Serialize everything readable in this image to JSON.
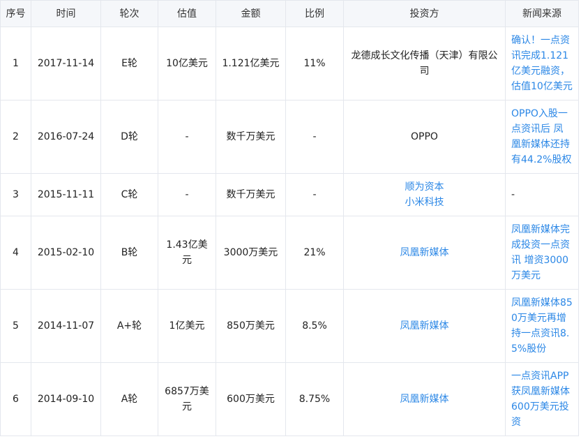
{
  "headers": {
    "index": "序号",
    "date": "时间",
    "round": "轮次",
    "valuation": "估值",
    "amount": "金额",
    "ratio": "比例",
    "investors": "投资方",
    "news": "新闻来源"
  },
  "rows": [
    {
      "index": "1",
      "date": "2017-11-14",
      "round": "E轮",
      "valuation": "10亿美元",
      "amount": "1.121亿美元",
      "ratio": "11%",
      "investors": [
        "龙德成长文化传播（天津）有限公司"
      ],
      "news": "确认！一点资讯完成1.121亿美元融资，估值10亿美元"
    },
    {
      "index": "2",
      "date": "2016-07-24",
      "round": "D轮",
      "valuation": "-",
      "amount": "数千万美元",
      "ratio": "-",
      "investors": [
        "OPPO"
      ],
      "news": "OPPO入股一点资讯后 凤凰新媒体还持有44.2%股权"
    },
    {
      "index": "3",
      "date": "2015-11-11",
      "round": "C轮",
      "valuation": "-",
      "amount": "数千万美元",
      "ratio": "-",
      "investors": [
        "顺为资本",
        "小米科技"
      ],
      "news": "-"
    },
    {
      "index": "4",
      "date": "2015-02-10",
      "round": "B轮",
      "valuation": "1.43亿美元",
      "amount": "3000万美元",
      "ratio": "21%",
      "investors": [
        "凤凰新媒体"
      ],
      "news": "凤凰新媒体完成投资一点资讯 增资3000万美元"
    },
    {
      "index": "5",
      "date": "2014-11-07",
      "round": "A+轮",
      "valuation": "1亿美元",
      "amount": "850万美元",
      "ratio": "8.5%",
      "investors": [
        "凤凰新媒体"
      ],
      "news": "凤凰新媒体850万美元再增持一点资讯8.5%股份"
    },
    {
      "index": "6",
      "date": "2014-09-10",
      "round": "A轮",
      "valuation": "6857万美元",
      "amount": "600万美元",
      "ratio": "8.75%",
      "investors": [
        "凤凰新媒体"
      ],
      "news": "一点资讯APP获凤凰新媒体600万美元投资"
    }
  ],
  "colors": {
    "link": "#2b87e6",
    "header_bg": "#f5f7fa",
    "border": "#e4e7ed"
  }
}
